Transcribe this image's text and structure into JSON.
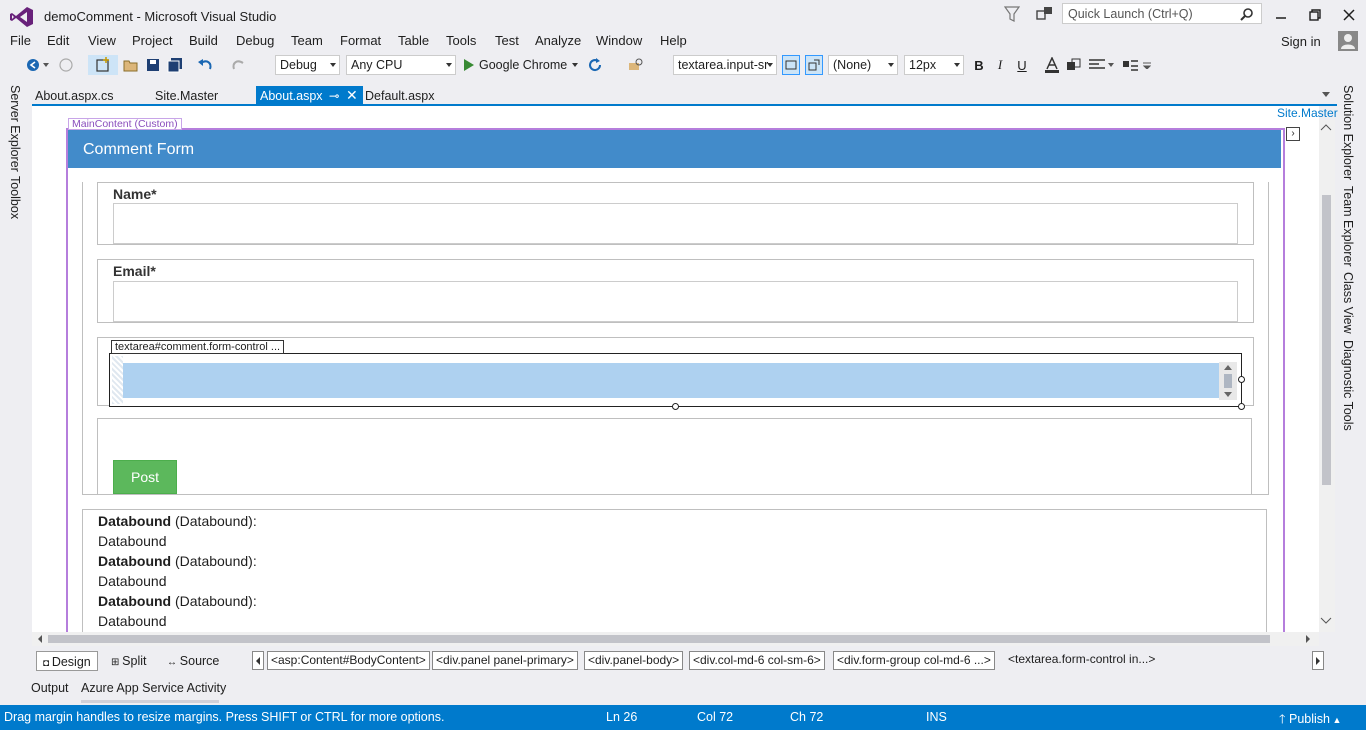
{
  "window": {
    "title": "demoComment - Microsoft Visual Studio",
    "quick_launch_placeholder": "Quick Launch (Ctrl+Q)"
  },
  "menu": [
    "File",
    "Edit",
    "View",
    "Project",
    "Build",
    "Debug",
    "Team",
    "Format",
    "Table",
    "Tools",
    "Test",
    "Analyze",
    "Window",
    "Help"
  ],
  "sign_in": "Sign in",
  "toolbar": {
    "configuration": "Debug",
    "platform": "Any CPU",
    "run_target": "Google Chrome",
    "target_element": "textarea.input-sr",
    "style": "(None)",
    "font_size": "12px",
    "bold": "B",
    "italic": "I",
    "underline": "U"
  },
  "left_tabs": [
    "Server Explorer",
    "Toolbox"
  ],
  "right_tabs": [
    "Solution Explorer",
    "Team Explorer",
    "Class View",
    "Diagnostic Tools"
  ],
  "doc_tabs": [
    "About.aspx.cs",
    "Site.Master",
    "About.aspx",
    "Default.aspx"
  ],
  "master_link": "Site.Master",
  "designer": {
    "content_region": "MainContent (Custom)",
    "panel_title": "Comment Form",
    "name_label": "Name*",
    "email_label": "Email*",
    "textarea_tag": "textarea#comment.form-control ...",
    "post_button": "Post",
    "databound": [
      {
        "bold": "Databound",
        "rest": " (Databound):",
        "value": "Databound"
      },
      {
        "bold": "Databound",
        "rest": " (Databound):",
        "value": "Databound"
      },
      {
        "bold": "Databound",
        "rest": " (Databound):",
        "value": "Databound"
      }
    ]
  },
  "views": {
    "design": "Design",
    "split": "Split",
    "source": "Source"
  },
  "breadcrumbs": [
    "<asp:Content#BodyContent>",
    "<div.panel panel-primary>",
    "<div.panel-body>",
    "<div.col-md-6 col-sm-6>",
    "<div.form-group col-md-6 ...>",
    "<textarea.form-control in...>"
  ],
  "output_tabs": [
    "Output",
    "Azure App Service Activity"
  ],
  "status": {
    "message": "Drag margin handles to resize margins. Press SHIFT or CTRL for more options.",
    "line": "Ln 26",
    "col": "Col 72",
    "ch": "Ch 72",
    "mode": "INS",
    "publish": "Publish"
  }
}
